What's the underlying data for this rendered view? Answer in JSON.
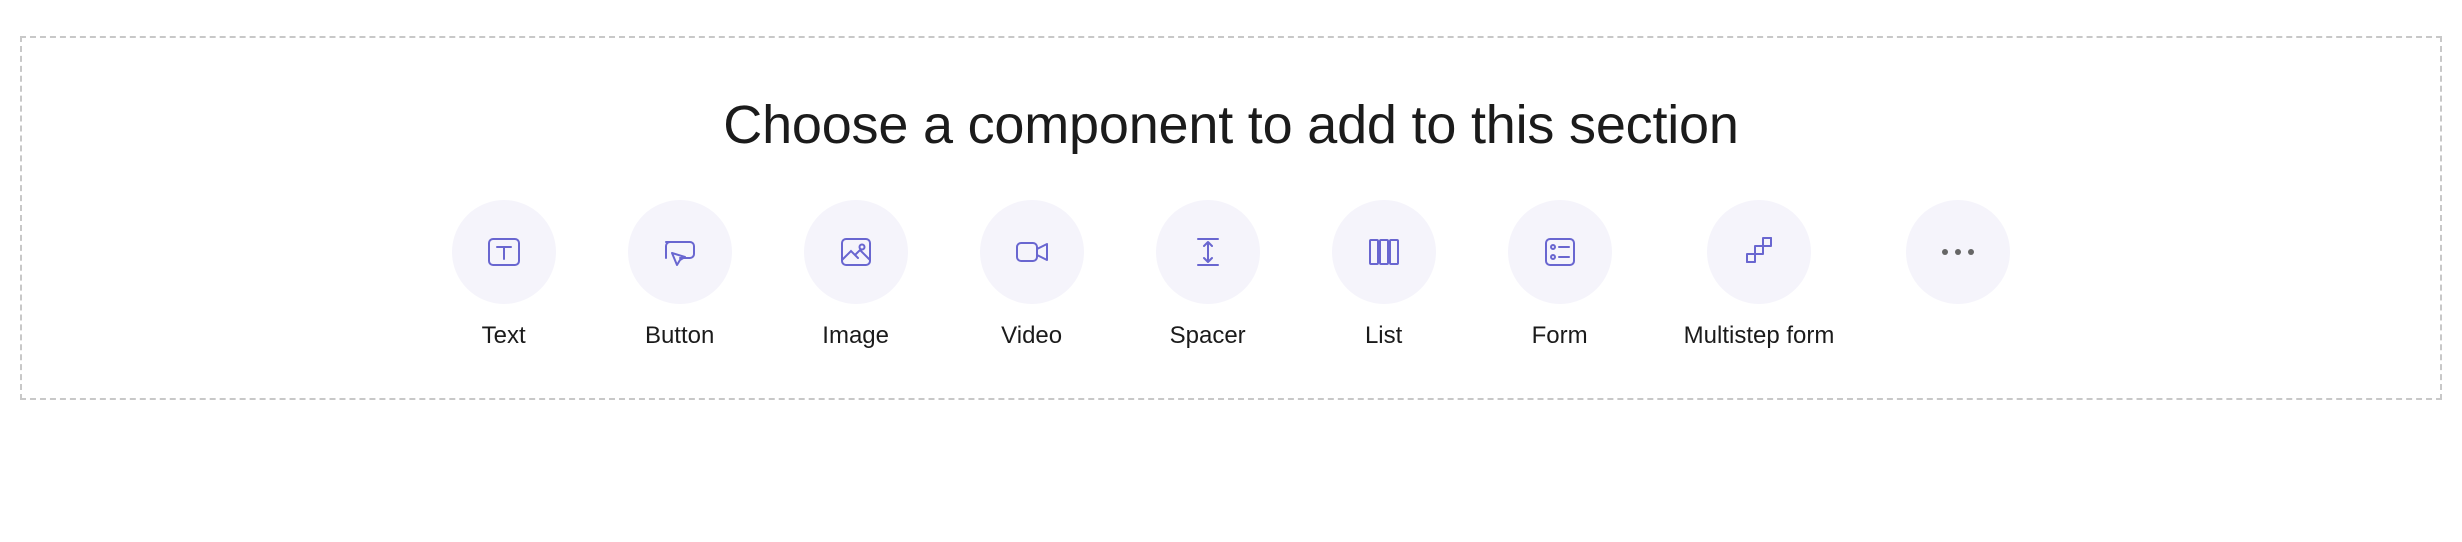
{
  "colors": {
    "accent": "#6966d0",
    "circleBg": "#f5f4fb",
    "border": "#c8c8c8",
    "text": "#1b1b1b"
  },
  "section": {
    "heading": "Choose a component to add to this section"
  },
  "components": [
    {
      "id": "text",
      "label": "Text",
      "icon": "text-icon"
    },
    {
      "id": "button",
      "label": "Button",
      "icon": "button-cursor-icon"
    },
    {
      "id": "image",
      "label": "Image",
      "icon": "image-icon"
    },
    {
      "id": "video",
      "label": "Video",
      "icon": "video-icon"
    },
    {
      "id": "spacer",
      "label": "Spacer",
      "icon": "spacer-icon"
    },
    {
      "id": "list",
      "label": "List",
      "icon": "list-columns-icon"
    },
    {
      "id": "form",
      "label": "Form",
      "icon": "form-icon"
    },
    {
      "id": "multistep-form",
      "label": "Multistep form",
      "icon": "multistep-icon"
    }
  ],
  "more": {
    "id": "more",
    "label": "",
    "icon": "more-icon"
  }
}
